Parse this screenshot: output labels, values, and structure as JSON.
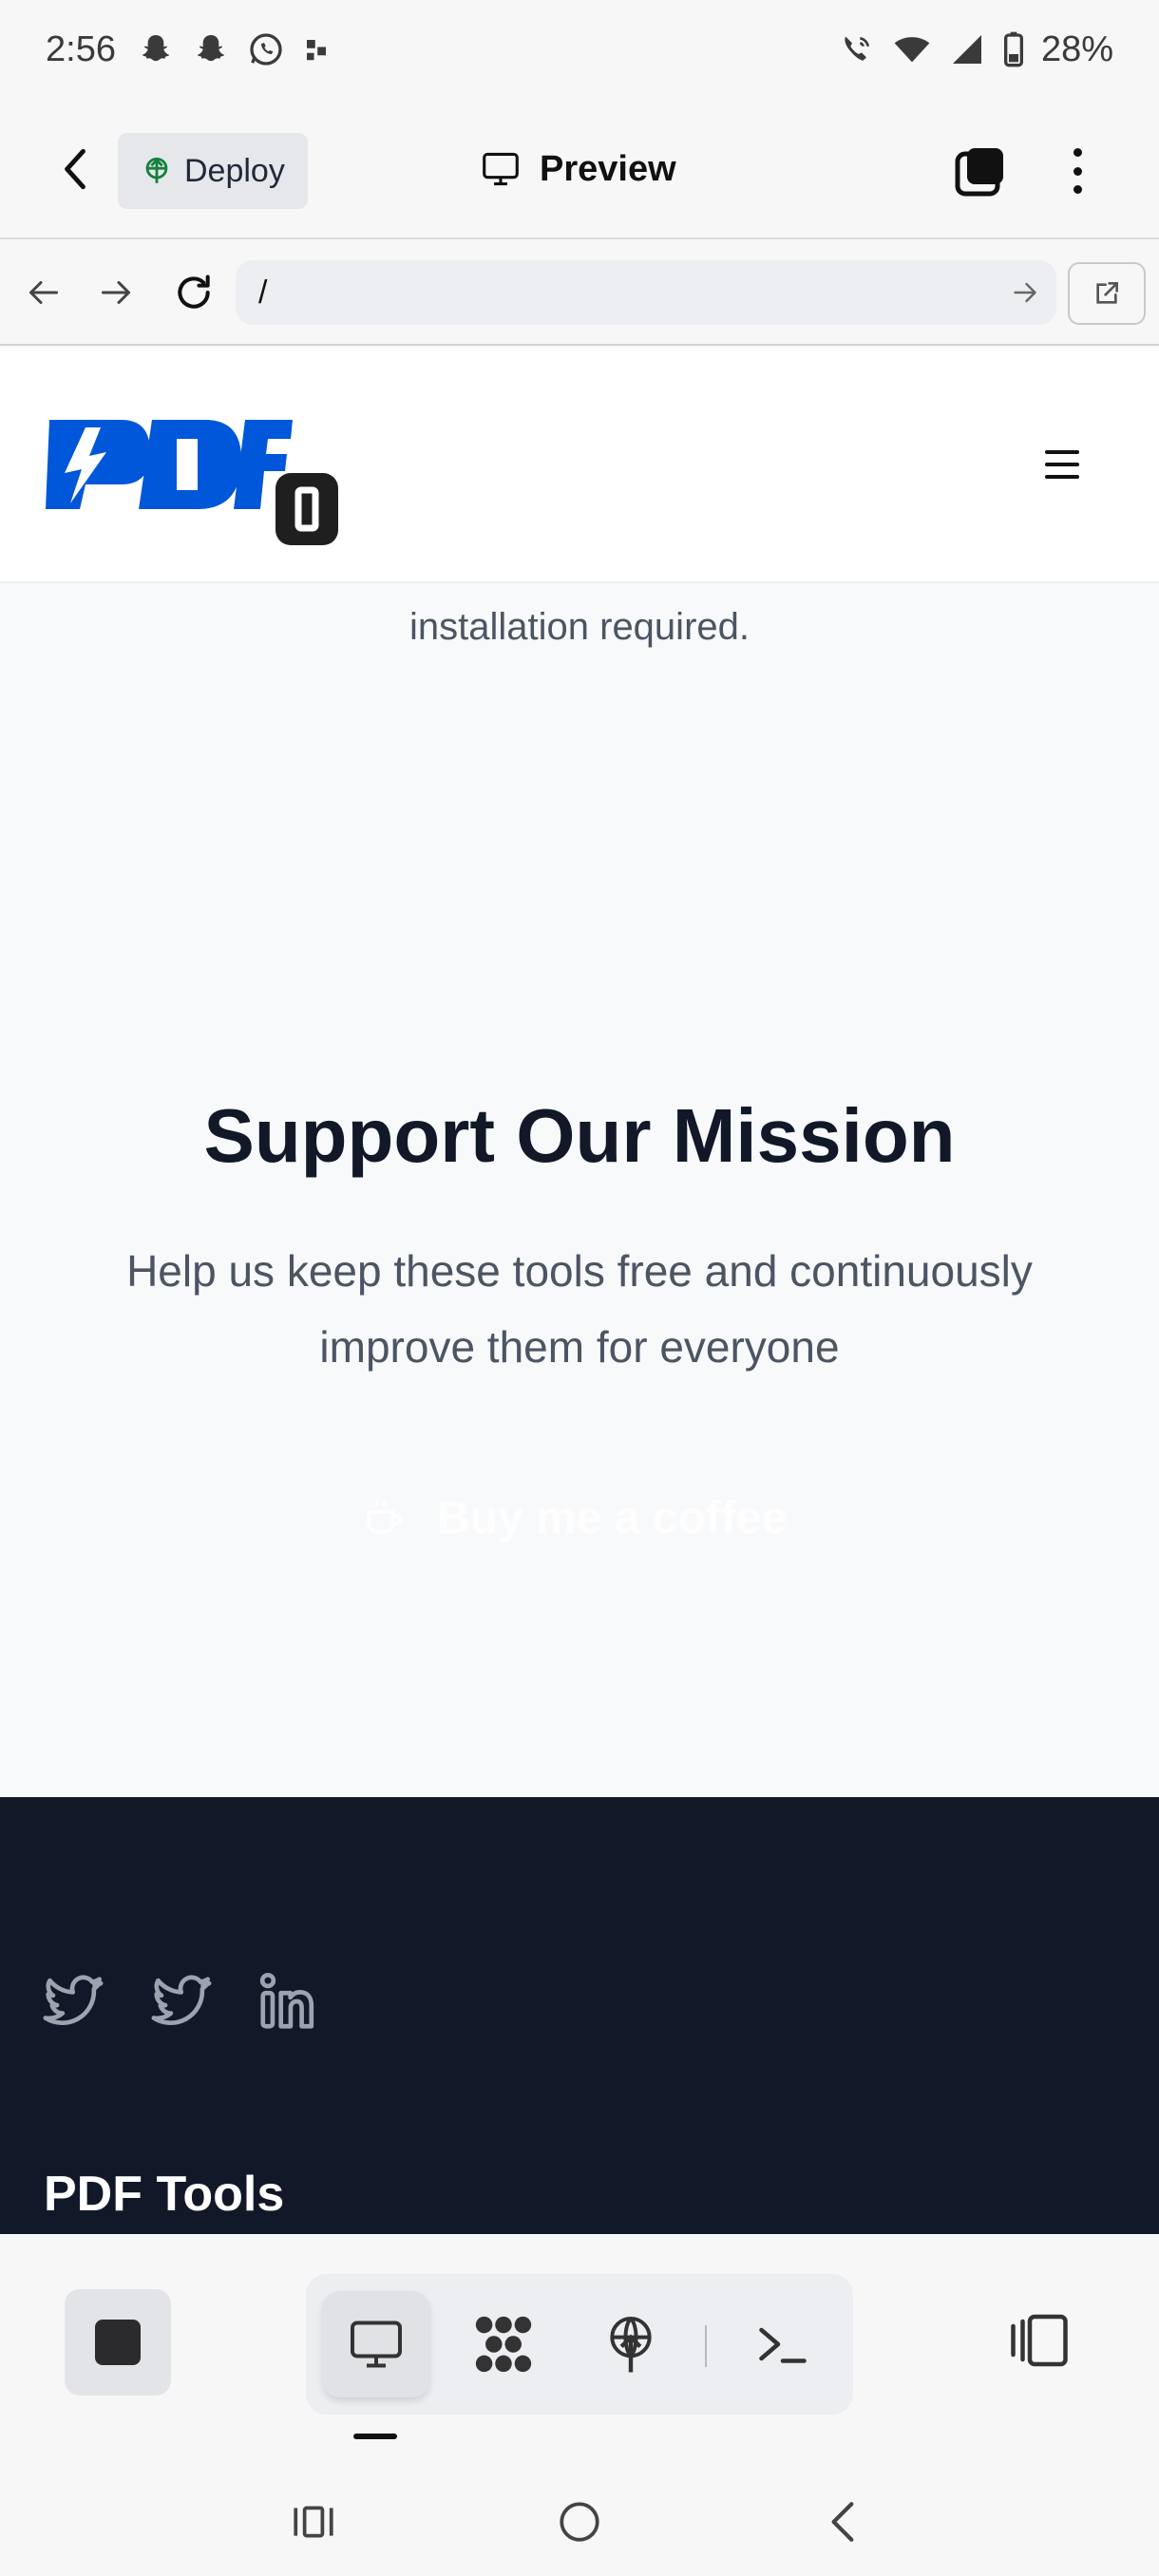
{
  "status_bar": {
    "time": "2:56",
    "battery": "28%"
  },
  "app_header": {
    "deploy_label": "Deploy",
    "preview_label": "Preview"
  },
  "url_bar": {
    "url": "/"
  },
  "site": {
    "install_text": "installation required.",
    "mission_title": "Support Our Mission",
    "mission_subtitle": "Help us keep these tools free and continuously improve them for everyone",
    "coffee_button": "Buy me a coffee",
    "footer_title": "PDF Tools"
  },
  "colors": {
    "logo_blue": "#0057d9",
    "footer_bg": "#111827"
  },
  "icons": [
    "back-icon",
    "deploy-icon",
    "monitor-icon",
    "tabs-icon",
    "more-icon",
    "arrow-left-icon",
    "arrow-right-icon",
    "reload-icon",
    "open-external-icon",
    "hamburger-icon",
    "coffee-icon",
    "twitter-icon",
    "linkedin-icon",
    "stop-icon",
    "workflow-icon",
    "deploy-icon",
    "terminal-icon",
    "split-view-icon"
  ]
}
